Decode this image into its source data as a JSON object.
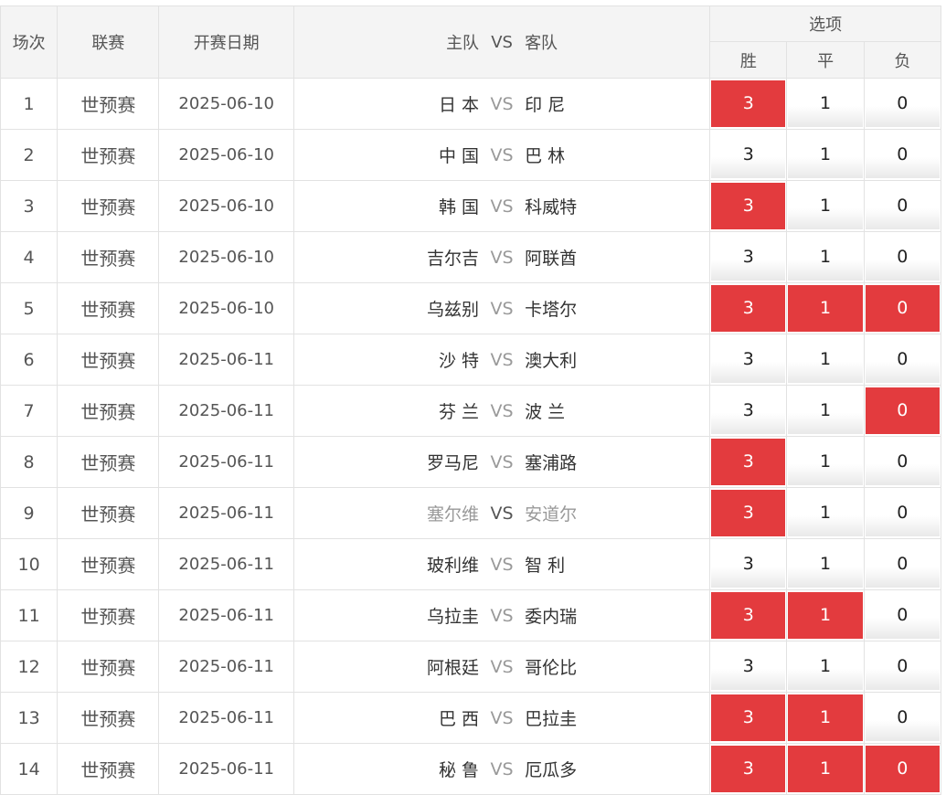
{
  "headers": {
    "index": "场次",
    "league": "联赛",
    "date": "开赛日期",
    "home": "主队",
    "vs": "VS",
    "away": "客队",
    "options": "选项",
    "win": "胜",
    "draw": "平",
    "lose": "负"
  },
  "colors": {
    "selected_bg": "#e33b3e",
    "selected_text": "#ffffff",
    "header_bg": "#f4f4f4",
    "vs_text": "#999999"
  },
  "rows": [
    {
      "index": "1",
      "league": "世预赛",
      "date": "2025-06-10",
      "home": "日 本",
      "vs": "VS",
      "away": "印 尼",
      "win": "3",
      "draw": "1",
      "lose": "0",
      "win_selected": true,
      "draw_selected": false,
      "lose_selected": false,
      "muted": false
    },
    {
      "index": "2",
      "league": "世预赛",
      "date": "2025-06-10",
      "home": "中 国",
      "vs": "VS",
      "away": "巴 林",
      "win": "3",
      "draw": "1",
      "lose": "0",
      "win_selected": false,
      "draw_selected": false,
      "lose_selected": false,
      "muted": false
    },
    {
      "index": "3",
      "league": "世预赛",
      "date": "2025-06-10",
      "home": "韩 国",
      "vs": "VS",
      "away": "科威特",
      "win": "3",
      "draw": "1",
      "lose": "0",
      "win_selected": true,
      "draw_selected": false,
      "lose_selected": false,
      "muted": false
    },
    {
      "index": "4",
      "league": "世预赛",
      "date": "2025-06-10",
      "home": "吉尔吉",
      "vs": "VS",
      "away": "阿联酋",
      "win": "3",
      "draw": "1",
      "lose": "0",
      "win_selected": false,
      "draw_selected": false,
      "lose_selected": false,
      "muted": false
    },
    {
      "index": "5",
      "league": "世预赛",
      "date": "2025-06-10",
      "home": "乌兹别",
      "vs": "VS",
      "away": "卡塔尔",
      "win": "3",
      "draw": "1",
      "lose": "0",
      "win_selected": true,
      "draw_selected": true,
      "lose_selected": true,
      "muted": false
    },
    {
      "index": "6",
      "league": "世预赛",
      "date": "2025-06-11",
      "home": "沙 特",
      "vs": "VS",
      "away": "澳大利",
      "win": "3",
      "draw": "1",
      "lose": "0",
      "win_selected": false,
      "draw_selected": false,
      "lose_selected": false,
      "muted": false
    },
    {
      "index": "7",
      "league": "世预赛",
      "date": "2025-06-11",
      "home": "芬 兰",
      "vs": "VS",
      "away": "波 兰",
      "win": "3",
      "draw": "1",
      "lose": "0",
      "win_selected": false,
      "draw_selected": false,
      "lose_selected": true,
      "muted": false
    },
    {
      "index": "8",
      "league": "世预赛",
      "date": "2025-06-11",
      "home": "罗马尼",
      "vs": "VS",
      "away": "塞浦路",
      "win": "3",
      "draw": "1",
      "lose": "0",
      "win_selected": true,
      "draw_selected": false,
      "lose_selected": false,
      "muted": false
    },
    {
      "index": "9",
      "league": "世预赛",
      "date": "2025-06-11",
      "home": "塞尔维",
      "vs": "VS",
      "away": "安道尔",
      "win": "3",
      "draw": "1",
      "lose": "0",
      "win_selected": true,
      "draw_selected": false,
      "lose_selected": false,
      "muted": true
    },
    {
      "index": "10",
      "league": "世预赛",
      "date": "2025-06-11",
      "home": "玻利维",
      "vs": "VS",
      "away": "智 利",
      "win": "3",
      "draw": "1",
      "lose": "0",
      "win_selected": false,
      "draw_selected": false,
      "lose_selected": false,
      "muted": false
    },
    {
      "index": "11",
      "league": "世预赛",
      "date": "2025-06-11",
      "home": "乌拉圭",
      "vs": "VS",
      "away": "委内瑞",
      "win": "3",
      "draw": "1",
      "lose": "0",
      "win_selected": true,
      "draw_selected": true,
      "lose_selected": false,
      "muted": false
    },
    {
      "index": "12",
      "league": "世预赛",
      "date": "2025-06-11",
      "home": "阿根廷",
      "vs": "VS",
      "away": "哥伦比",
      "win": "3",
      "draw": "1",
      "lose": "0",
      "win_selected": false,
      "draw_selected": false,
      "lose_selected": false,
      "muted": false
    },
    {
      "index": "13",
      "league": "世预赛",
      "date": "2025-06-11",
      "home": "巴 西",
      "vs": "VS",
      "away": "巴拉圭",
      "win": "3",
      "draw": "1",
      "lose": "0",
      "win_selected": true,
      "draw_selected": true,
      "lose_selected": false,
      "muted": false
    },
    {
      "index": "14",
      "league": "世预赛",
      "date": "2025-06-11",
      "home": "秘 鲁",
      "vs": "VS",
      "away": "厄瓜多",
      "win": "3",
      "draw": "1",
      "lose": "0",
      "win_selected": true,
      "draw_selected": true,
      "lose_selected": true,
      "muted": false
    }
  ]
}
